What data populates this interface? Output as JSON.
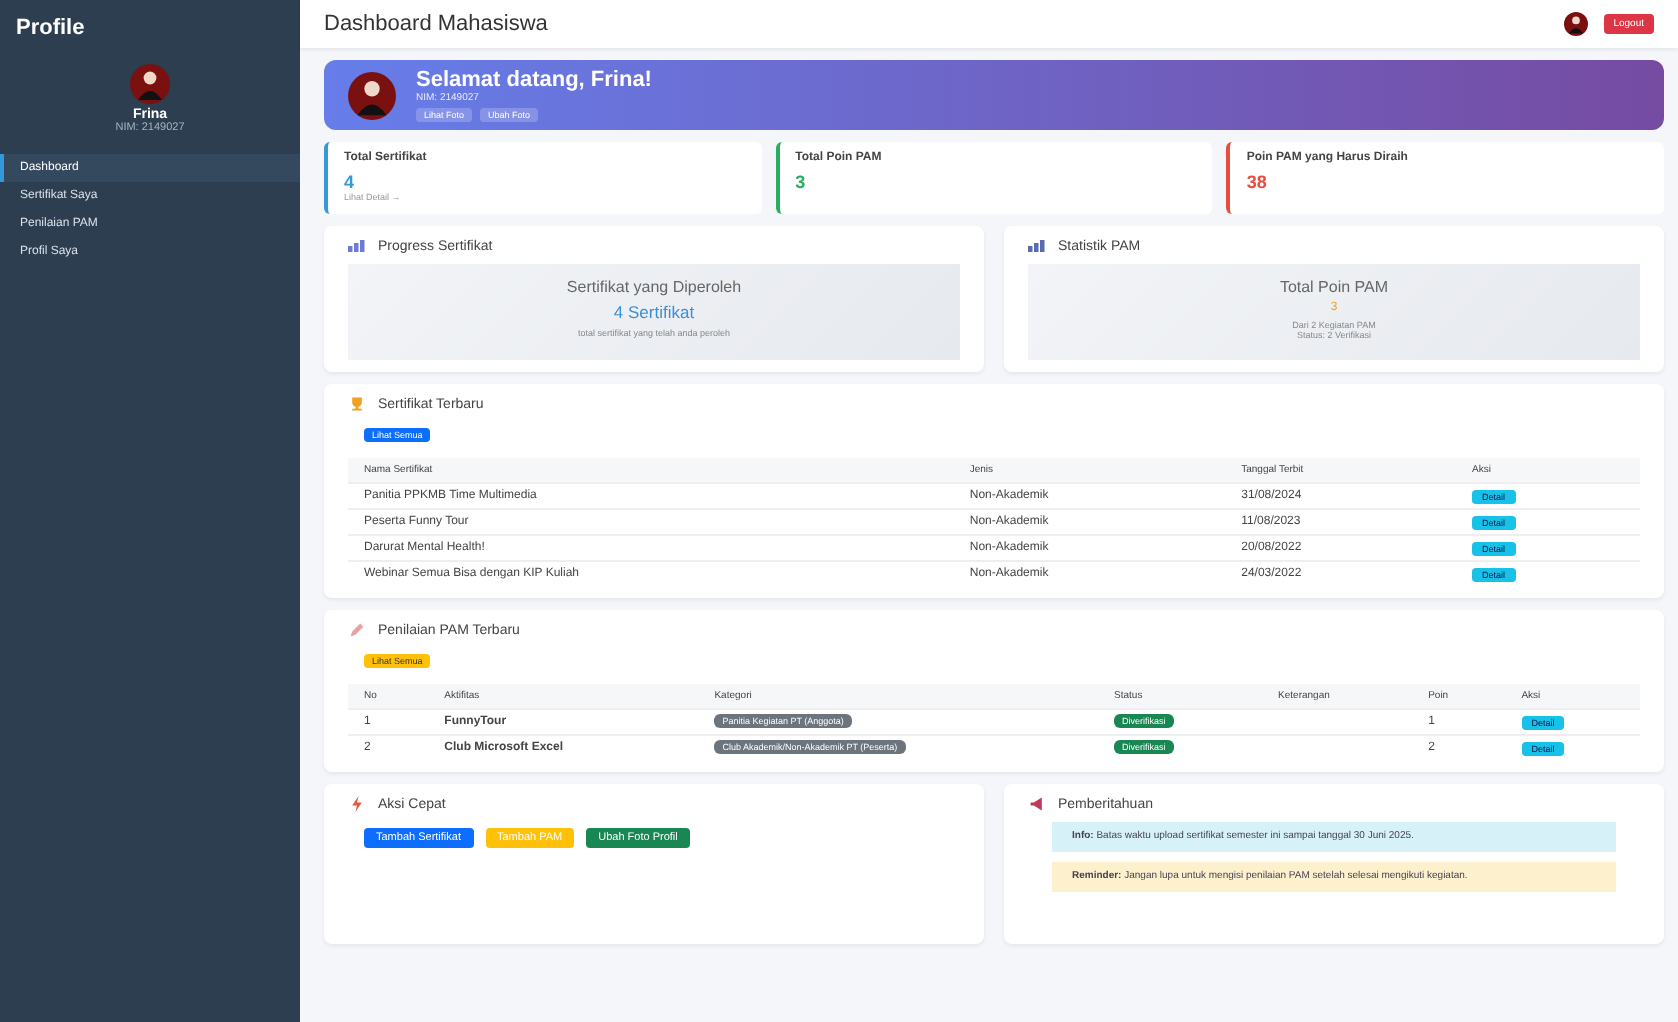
{
  "sidebar": {
    "title": "Profile",
    "user": {
      "name": "Frina",
      "nim": "NIM: 2149027"
    },
    "items": [
      {
        "label": "Dashboard",
        "selected": true
      },
      {
        "label": "Sertifikat Saya",
        "selected": false
      },
      {
        "label": "Penilaian PAM",
        "selected": false
      },
      {
        "label": "Profil Saya",
        "selected": false
      }
    ]
  },
  "header": {
    "title": "Dashboard Mahasiswa",
    "logout": "Logout"
  },
  "hero": {
    "greeting": "Selamat datang, Frina!",
    "nim": "NIM: 2149027",
    "buttons": [
      "Lihat Foto",
      "Ubah Foto"
    ]
  },
  "stats": [
    {
      "label": "Total Sertifikat",
      "value": "4",
      "link": "Lihat Detail →",
      "color": "#3498db"
    },
    {
      "label": "Total Poin PAM",
      "value": "3",
      "color": "#27ae60"
    },
    {
      "label": "Poin PAM yang Harus Diraih",
      "value": "38",
      "color": "#e74c3c"
    }
  ],
  "progress": {
    "title": "Progress Sertifikat",
    "heading": "Sertifikat yang Diperoleh",
    "value": "4 Sertifikat",
    "note": "total sertifikat yang telah anda peroleh"
  },
  "statistik": {
    "title": "Statistik PAM",
    "heading": "Total Poin PAM",
    "value": "3",
    "lines": [
      "Dari 2 Kegiatan PAM",
      "Status: 2 Verifikasi"
    ]
  },
  "certificates": {
    "title": "Sertifikat Terbaru",
    "view_all": "Lihat Semua",
    "columns": [
      "Nama Sertifikat",
      "Jenis",
      "Tanggal Terbit",
      "Aksi"
    ],
    "rows": [
      [
        "Panitia PPKMB Time Multimedia",
        "Non-Akademik",
        "31/08/2024",
        "Detail"
      ],
      [
        "Peserta Funny Tour",
        "Non-Akademik",
        "11/08/2023",
        "Detail"
      ],
      [
        "Darurat Mental Health!",
        "Non-Akademik",
        "20/08/2022",
        "Detail"
      ],
      [
        "Webinar Semua Bisa dengan KIP Kuliah",
        "Non-Akademik",
        "24/03/2022",
        "Detail"
      ]
    ]
  },
  "pam": {
    "title": "Penilaian PAM Terbaru",
    "view_all": "Lihat Semua",
    "columns": [
      "No",
      "Aktifitas",
      "Kategori",
      "Status",
      "Keterangan",
      "Poin",
      "Aksi"
    ],
    "rows": [
      {
        "no": "1",
        "activity": "FunnyTour",
        "category": "Panitia Kegiatan PT (Anggota)",
        "status": "Diverifikasi",
        "points": "1",
        "action": "Detail"
      },
      {
        "no": "2",
        "activity": "Club Microsoft Excel",
        "category": "Club Akademik/Non-Akademik PT (Peserta)",
        "status": "Diverifikasi",
        "points": "2",
        "action": "Detail"
      }
    ]
  },
  "quick_actions": {
    "title": "Aksi Cepat",
    "buttons": [
      {
        "label": "Tambah Sertifikat",
        "color": "#0d6efd"
      },
      {
        "label": "Tambah PAM",
        "color": "#ffc107"
      },
      {
        "label": "Ubah Foto Profil",
        "color": "#198754"
      }
    ]
  },
  "notices": {
    "title": "Pemberitahuan",
    "items": [
      {
        "kind": "info",
        "text": "**Info:** Batas waktu upload sertifikat semester ini sampai tanggal 30 Juni 2025."
      },
      {
        "kind": "warning",
        "text": "**Reminder:** Jangan lupa untuk mengisi penilaian PAM setelah selesai mengikuti kegiatan."
      }
    ]
  }
}
